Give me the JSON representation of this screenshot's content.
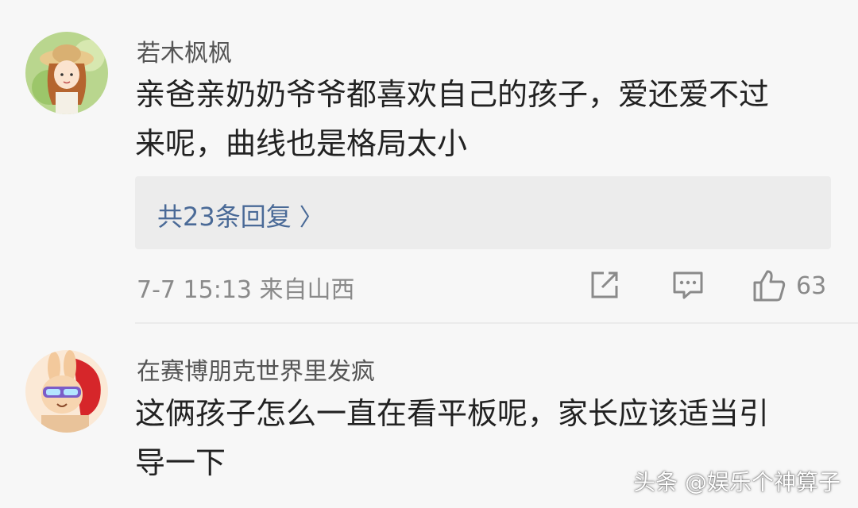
{
  "comments": [
    {
      "username": "若木枫枫",
      "avatar_icon": "girl-with-straw-hat-avatar",
      "text_lines": [
        "亲爸亲奶奶爷爷都喜欢自己的孩子，爱还爱不过",
        "来呢，曲线也是格局太小"
      ],
      "replies_label": "共23条回复",
      "meta": "7-7 15:13 来自山西",
      "like_count": "63"
    },
    {
      "username": "在赛博朋克世界里发疯",
      "avatar_icon": "bunny-with-sunglasses-avatar",
      "text_lines": [
        "这俩孩子怎么一直在看平板呢，家长应该适当引",
        "导一下"
      ]
    }
  ],
  "watermark": "头条 @娱乐个神算子",
  "colors": {
    "background": "#f7f7f7",
    "link": "#4a6a97",
    "meta": "#8a8a8a",
    "text": "#222222"
  }
}
